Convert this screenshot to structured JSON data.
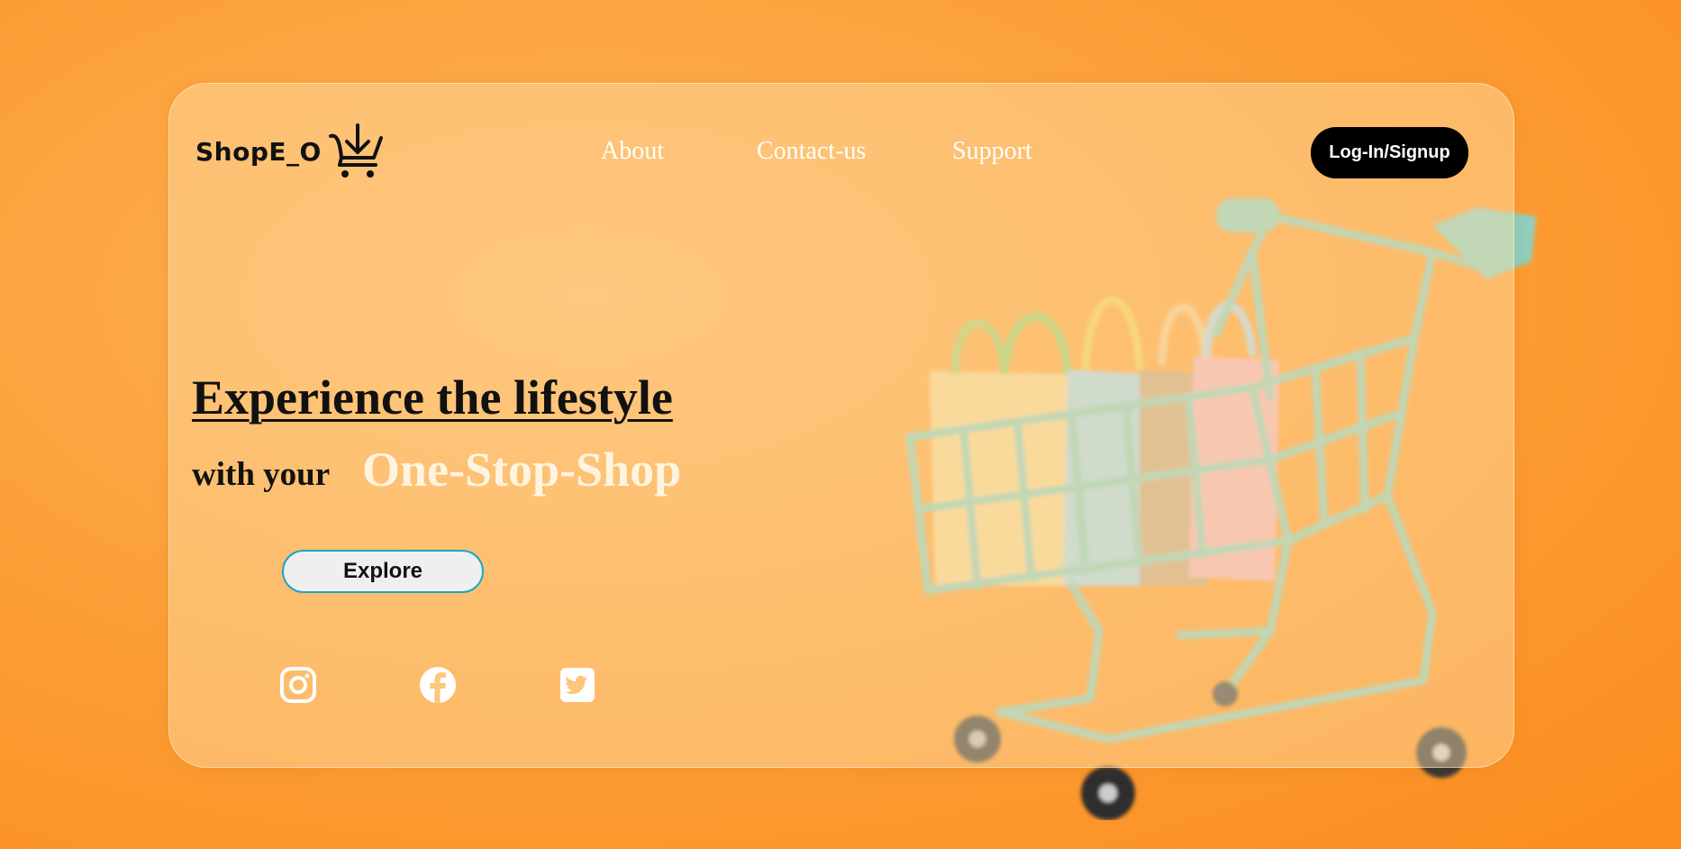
{
  "brand": {
    "name": "ShopE_O",
    "logo_icon": "download-cart-icon"
  },
  "nav": {
    "links": [
      "About",
      "Contact-us",
      "Support"
    ],
    "login_label": "Log-In/Signup"
  },
  "hero": {
    "headline": "Experience the lifestyle",
    "subline_prefix": "with your",
    "subline_highlight": "One-Stop-Shop",
    "cta_label": "Explore"
  },
  "social": [
    {
      "icon": "instagram-icon"
    },
    {
      "icon": "facebook-icon"
    },
    {
      "icon": "twitter-icon"
    }
  ],
  "colors": {
    "background": "#fca13a",
    "accent_border": "#1aa6c6",
    "cart": "#8fcfbd"
  }
}
